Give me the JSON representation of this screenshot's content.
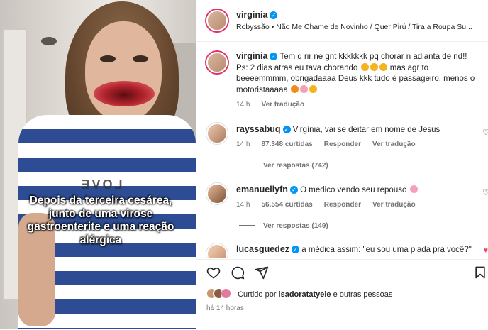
{
  "video": {
    "caption": "Depois da terceira cesárea,\njunto de uma virose\ngastroenterite e uma reação\nalérgica",
    "shirt_text": "LOVE"
  },
  "header": {
    "username": "virginia",
    "audio": "Robyssão • Não Me Chame de Novinho / Quer Pirú / Tira a Roupa Su..."
  },
  "caption_post": {
    "username": "virginia",
    "text_1": "Tem q rir ne gnt kkkkkkk pq chorar n adianta de nd!!",
    "text_2": "Ps: 2 dias atras eu tava chorando",
    "text_3": "mas agr to beeeemmmm, obrigadaaaa Deus kkk tudo é passageiro, menos o motoristaaaaa",
    "time": "14 h",
    "see_translation": "Ver tradução"
  },
  "comments": [
    {
      "username": "rayssabuq",
      "text": "Virgínia, vai se deitar em nome de Jesus",
      "time": "14 h",
      "likes": "87.348 curtidas",
      "reply": "Responder",
      "see_translation": "Ver tradução",
      "view_replies": "Ver respostas (742)"
    },
    {
      "username": "emanuellyfn",
      "text": "O medico vendo seu repouso",
      "time": "14 h",
      "likes": "56.554 curtidas",
      "reply": "Responder",
      "see_translation": "Ver tradução",
      "view_replies": "Ver respostas (149)"
    },
    {
      "username": "lucasguedez",
      "text": "a médica assim: \"eu sou uma piada pra você?\""
    }
  ],
  "liked_by": {
    "prefix": "Curtido por",
    "user": "isadoratatyele",
    "suffix": "e outras pessoas"
  },
  "posted_ago": "há 14 horas",
  "icons": {
    "like": "heart-icon",
    "comment": "comment-icon",
    "share": "send-icon",
    "save": "bookmark-icon"
  },
  "colors": {
    "verified": "#0095f6",
    "liked_heart": "#ed4956",
    "text": "#262626",
    "muted": "#737373"
  }
}
